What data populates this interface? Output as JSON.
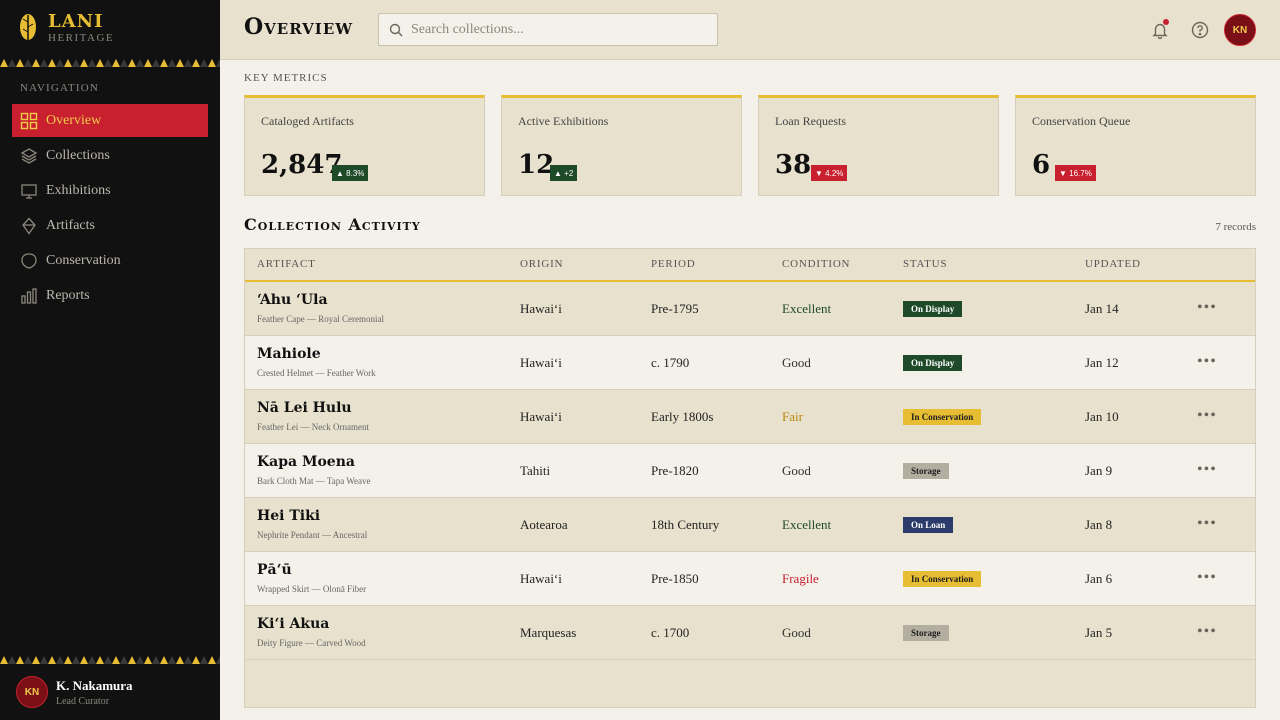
{
  "brand": {
    "name": "LANI",
    "subtitle": "HERITAGE",
    "logo_icon": "feather-leaf-icon"
  },
  "sidebar": {
    "heading": "NAVIGATION",
    "items": [
      {
        "label": "Overview",
        "icon": "grid-icon",
        "active": true
      },
      {
        "label": "Collections",
        "icon": "layers-icon",
        "active": false
      },
      {
        "label": "Exhibitions",
        "icon": "monitor-icon",
        "active": false
      },
      {
        "label": "Artifacts",
        "icon": "diamond-icon",
        "active": false
      },
      {
        "label": "Conservation",
        "icon": "shield-icon",
        "active": false
      },
      {
        "label": "Reports",
        "icon": "bar-chart-icon",
        "active": false
      }
    ],
    "user": {
      "initials": "KN",
      "name": "K. Nakamura",
      "role": "Lead Curator"
    }
  },
  "header": {
    "title": "Overview",
    "search_placeholder": "Search collections...",
    "avatar_initials": "KN",
    "has_notification": true
  },
  "metrics": {
    "section_label": "KEY METRICS",
    "cards": [
      {
        "label": "Cataloged Artifacts",
        "value": "2,847",
        "delta": "▲ 8.3%",
        "direction": "up"
      },
      {
        "label": "Active Exhibitions",
        "value": "12",
        "delta": "▲ +2",
        "direction": "up"
      },
      {
        "label": "Loan Requests",
        "value": "38",
        "delta": "▼ 4.2%",
        "direction": "down"
      },
      {
        "label": "Conservation Queue",
        "value": "6",
        "delta": "▼ 16.7%",
        "direction": "down"
      }
    ]
  },
  "activity": {
    "title": "Collection Activity",
    "records": "7 records",
    "columns": [
      "ARTIFACT",
      "ORIGIN",
      "PERIOD",
      "CONDITION",
      "STATUS",
      "UPDATED"
    ],
    "rows": [
      {
        "name": "ʻAhu ʻUla",
        "sub": "Feather Cape — Royal Ceremonial",
        "origin": "Hawaiʻi",
        "period": "Pre-1795",
        "condition": "Excellent",
        "status": "On Display",
        "updated": "Jan 14"
      },
      {
        "name": "Mahiole",
        "sub": "Crested Helmet — Feather Work",
        "origin": "Hawaiʻi",
        "period": "c. 1790",
        "condition": "Good",
        "status": "On Display",
        "updated": "Jan 12"
      },
      {
        "name": "Nā Lei Hulu",
        "sub": "Feather Lei — Neck Ornament",
        "origin": "Hawaiʻi",
        "period": "Early 1800s",
        "condition": "Fair",
        "status": "In Conservation",
        "updated": "Jan 10"
      },
      {
        "name": "Kapa Moena",
        "sub": "Bark Cloth Mat — Tapa Weave",
        "origin": "Tahiti",
        "period": "Pre-1820",
        "condition": "Good",
        "status": "Storage",
        "updated": "Jan 9"
      },
      {
        "name": "Hei Tiki",
        "sub": "Nephrite Pendant — Ancestral",
        "origin": "Aotearoa",
        "period": "18th Century",
        "condition": "Excellent",
        "status": "On Loan",
        "updated": "Jan 8"
      },
      {
        "name": "Pāʻū",
        "sub": "Wrapped Skirt — Olonā Fiber",
        "origin": "Hawaiʻi",
        "period": "Pre-1850",
        "condition": "Fragile",
        "status": "In Conservation",
        "updated": "Jan 6"
      },
      {
        "name": "Kiʻi Akua",
        "sub": "Deity Figure — Carved Wood",
        "origin": "Marquesas",
        "period": "c. 1700",
        "condition": "Good",
        "status": "Storage",
        "updated": "Jan 5"
      }
    ],
    "more_label": "•••"
  },
  "colors": {
    "sidebar_bg": "#111111",
    "accent_red": "#c8202f",
    "accent_gold": "#e6bd33",
    "panel_bg": "#e8e1cd",
    "green": "#1f4a2a",
    "navy": "#2a3b6c"
  }
}
